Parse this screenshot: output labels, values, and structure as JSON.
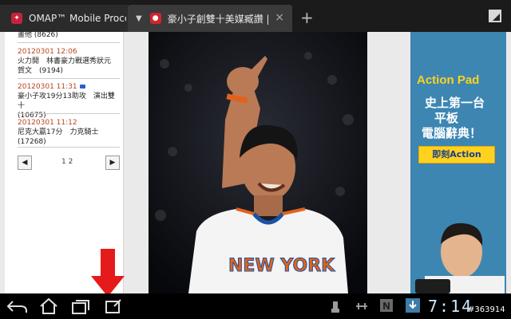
{
  "tabs": [
    {
      "title": "OMAP™ Mobile Processors",
      "favicon": "omap-favicon",
      "active": false
    },
    {
      "title": "豪小子創雙十美媒臧讚 | ...",
      "favicon": "news-favicon",
      "active": true
    }
  ],
  "tabbar": {
    "new_tab": "+",
    "close": "×"
  },
  "sidebar": {
    "news": [
      {
        "date": "",
        "text": "畫他 (8626)"
      },
      {
        "date": "20120301 12:06",
        "text": "火力開　林書豪力戰選秀狀元",
        "text2": "賀文　(9194)"
      },
      {
        "date": "20120301 11:31",
        "text": "豪小子攻19分13助攻　演出雙十",
        "text2": "(10675)",
        "video": true
      },
      {
        "date": "20120301 11:12",
        "text": "尼克大贏17分　力克騎士",
        "text2": "(17268)"
      }
    ],
    "pager": {
      "prev": "◀",
      "next": "▶",
      "pages": "1  2"
    }
  },
  "photo": {
    "jersey": "NEW YORK",
    "colors": {
      "jersey": "#f4f4f4",
      "trim": "#e2621b",
      "blue": "#1b52a4",
      "skin": "#b97a55"
    }
  },
  "ad": {
    "brand": "Action Pad",
    "lines": [
      "史上第一台",
      "平板",
      "電腦辭典！"
    ],
    "cta": "即刻Action"
  },
  "system": {
    "time": "7:14",
    "watermark": "#363914",
    "nav": [
      "back-icon",
      "home-icon",
      "recent-apps-icon",
      "screenshot-icon"
    ]
  }
}
